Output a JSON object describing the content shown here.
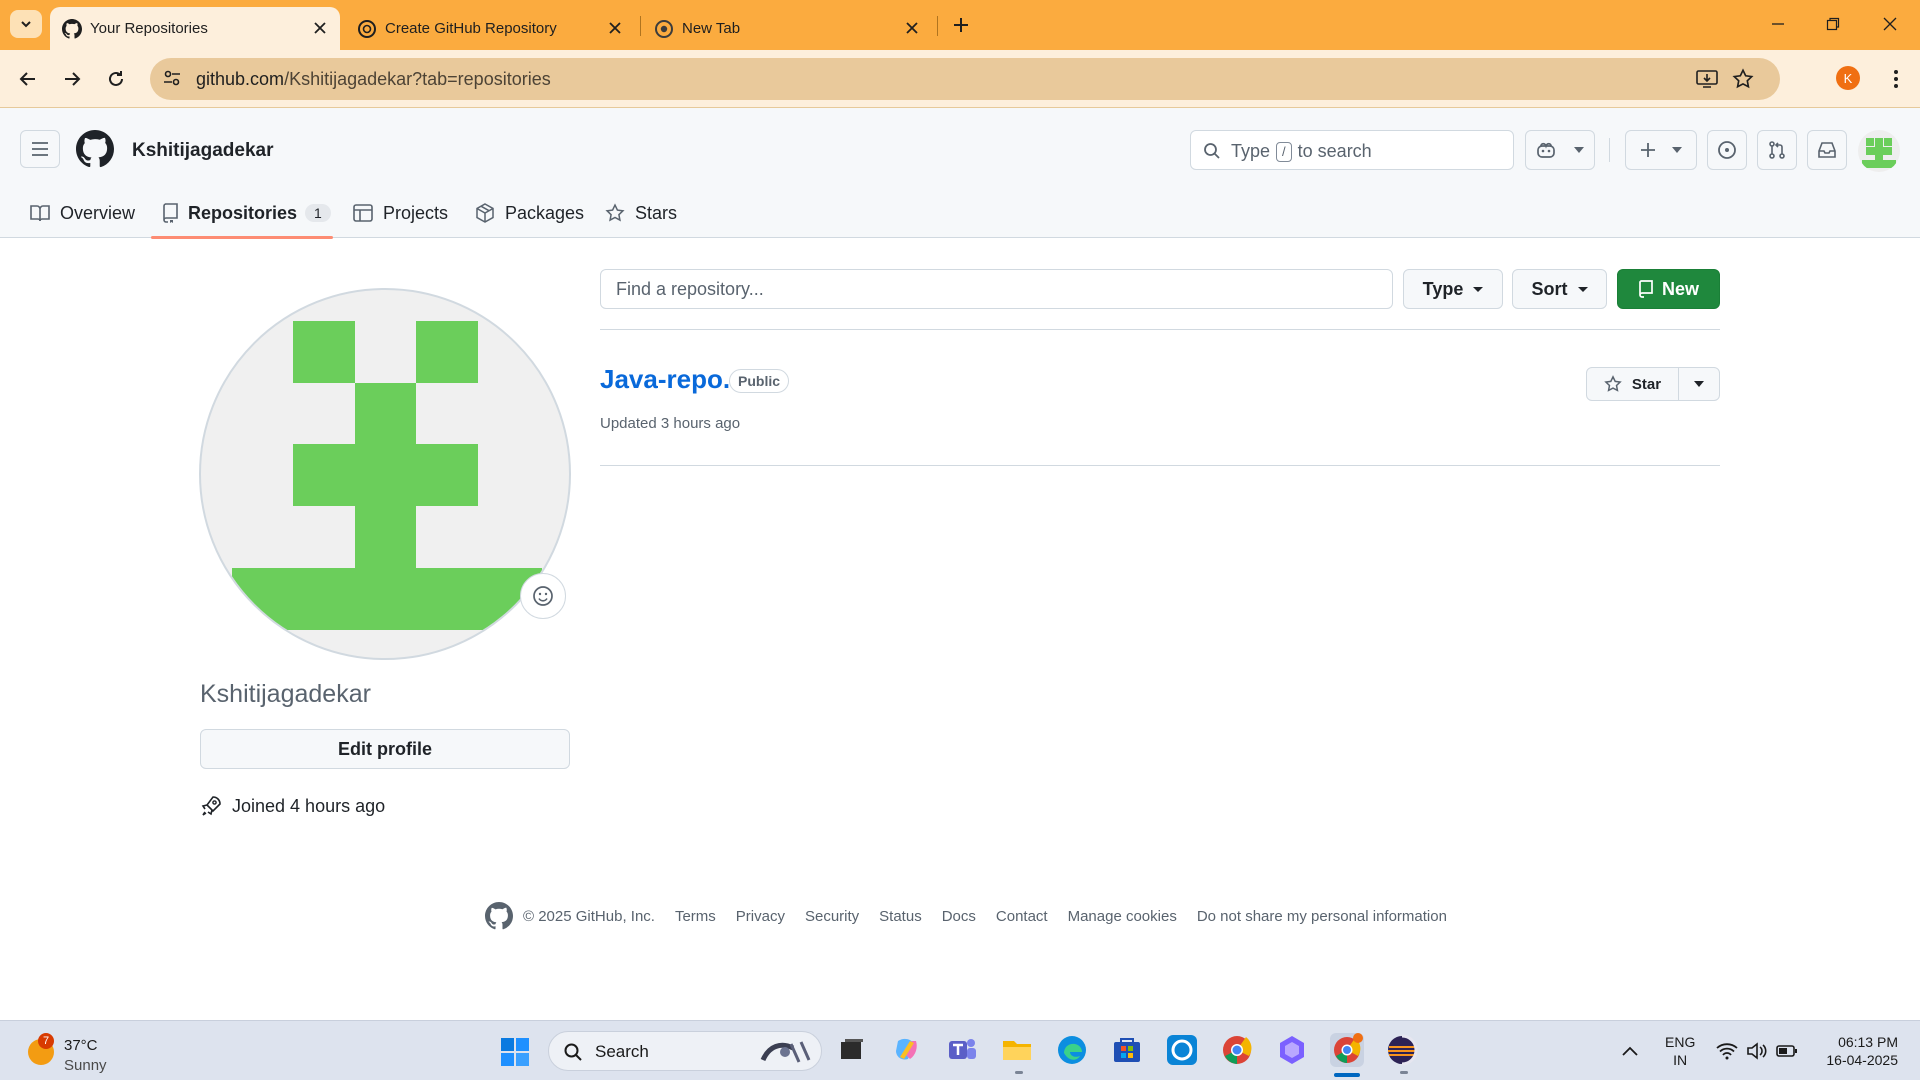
{
  "browser": {
    "tabs": [
      {
        "title": "Your Repositories",
        "active": true
      },
      {
        "title": "Create GitHub Repository",
        "active": false
      },
      {
        "title": "New Tab",
        "active": false
      }
    ],
    "url_host": "github.com",
    "url_path": "/Kshitijagadekar?tab=repositories",
    "profile_initial": "K",
    "accent": "#fbab3f"
  },
  "github": {
    "username": "Kshitijagadekar",
    "search": {
      "before": "Type",
      "key": "/",
      "after": "to search"
    },
    "nav": [
      {
        "label": "Overview",
        "icon": "book-icon"
      },
      {
        "label": "Repositories",
        "icon": "repo-icon",
        "count": "1",
        "active": true
      },
      {
        "label": "Projects",
        "icon": "table-icon"
      },
      {
        "label": "Packages",
        "icon": "package-icon"
      },
      {
        "label": "Stars",
        "icon": "star-icon"
      }
    ],
    "profile": {
      "name": "Kshitijagadekar",
      "edit_label": "Edit profile",
      "joined": "Joined 4 hours ago"
    },
    "repo_list": {
      "find_placeholder": "Find a repository...",
      "type_label": "Type",
      "sort_label": "Sort",
      "new_label": "New",
      "repos": [
        {
          "name": "Java-repo.",
          "visibility": "Public",
          "updated": "Updated 3 hours ago",
          "star_label": "Star"
        }
      ]
    },
    "footer": {
      "copyright": "© 2025 GitHub, Inc.",
      "links": [
        "Terms",
        "Privacy",
        "Security",
        "Status",
        "Docs",
        "Contact",
        "Manage cookies",
        "Do not share my personal information"
      ]
    },
    "colors": {
      "primary_button": "#1f883d",
      "link": "#0969da",
      "nav_underline": "#fd8c73",
      "identicon": "#6bce5b"
    }
  },
  "taskbar": {
    "weather": {
      "badge": "7",
      "temp": "37°C",
      "condition": "Sunny"
    },
    "search_label": "Search",
    "lang": {
      "line1": "ENG",
      "line2": "IN"
    },
    "clock": {
      "time": "06:13 PM",
      "date": "16-04-2025"
    }
  }
}
